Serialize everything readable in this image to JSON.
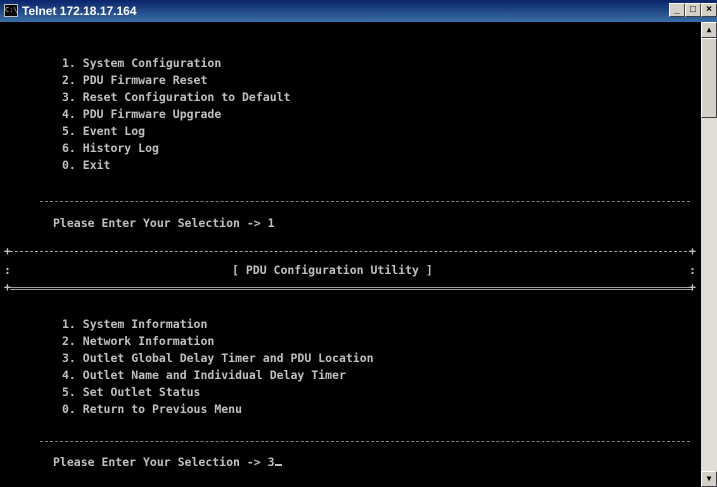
{
  "window": {
    "title": "Telnet 172.18.17.164",
    "icon": "telnet-terminal-icon",
    "minimize": "_",
    "maximize": "□",
    "close": "×"
  },
  "main_menu": {
    "items": [
      "1. System Configuration",
      "2. PDU Firmware Reset",
      "3. Reset Configuration to Default",
      "4. PDU Firmware Upgrade",
      "5. Event Log",
      "6. History Log",
      "0. Exit"
    ],
    "prompt": "Please Enter Your Selection -> 1"
  },
  "config_menu": {
    "header": "[ PDU Configuration Utility ]",
    "items": [
      "1. System Information",
      "2. Network Information",
      "3. Outlet Global Delay Timer and PDU Location",
      "4. Outlet Name and Individual Delay Timer",
      "5. Set Outlet Status",
      "0. Return to Previous Menu"
    ],
    "prompt": "Please Enter Your Selection -> 3"
  },
  "colors": {
    "terminal_background": "#000000",
    "terminal_text": "#c0c0c0",
    "titlebar": "#0a246a"
  }
}
